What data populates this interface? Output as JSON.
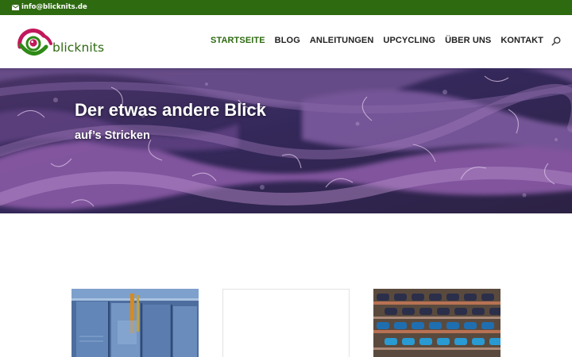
{
  "topbar": {
    "email": "info@blicknits.de",
    "email_icon": "envelope-icon"
  },
  "header": {
    "logo_text": "blicknits",
    "nav": [
      {
        "label": "STARTSEITE",
        "active": true
      },
      {
        "label": "BLOG",
        "active": false
      },
      {
        "label": "ANLEITUNGEN",
        "active": false
      },
      {
        "label": "UPCYCLING",
        "active": false
      },
      {
        "label": "ÜBER UNS",
        "active": false
      },
      {
        "label": "KONTAKT",
        "active": false
      }
    ],
    "search_icon": "search-icon"
  },
  "hero": {
    "title": "Der etwas andere Blick",
    "subtitle": "auf’s Stricken"
  },
  "colors": {
    "brand_green": "#2e6a10",
    "logo_pink": "#c2185b",
    "nav_text": "#222222"
  }
}
